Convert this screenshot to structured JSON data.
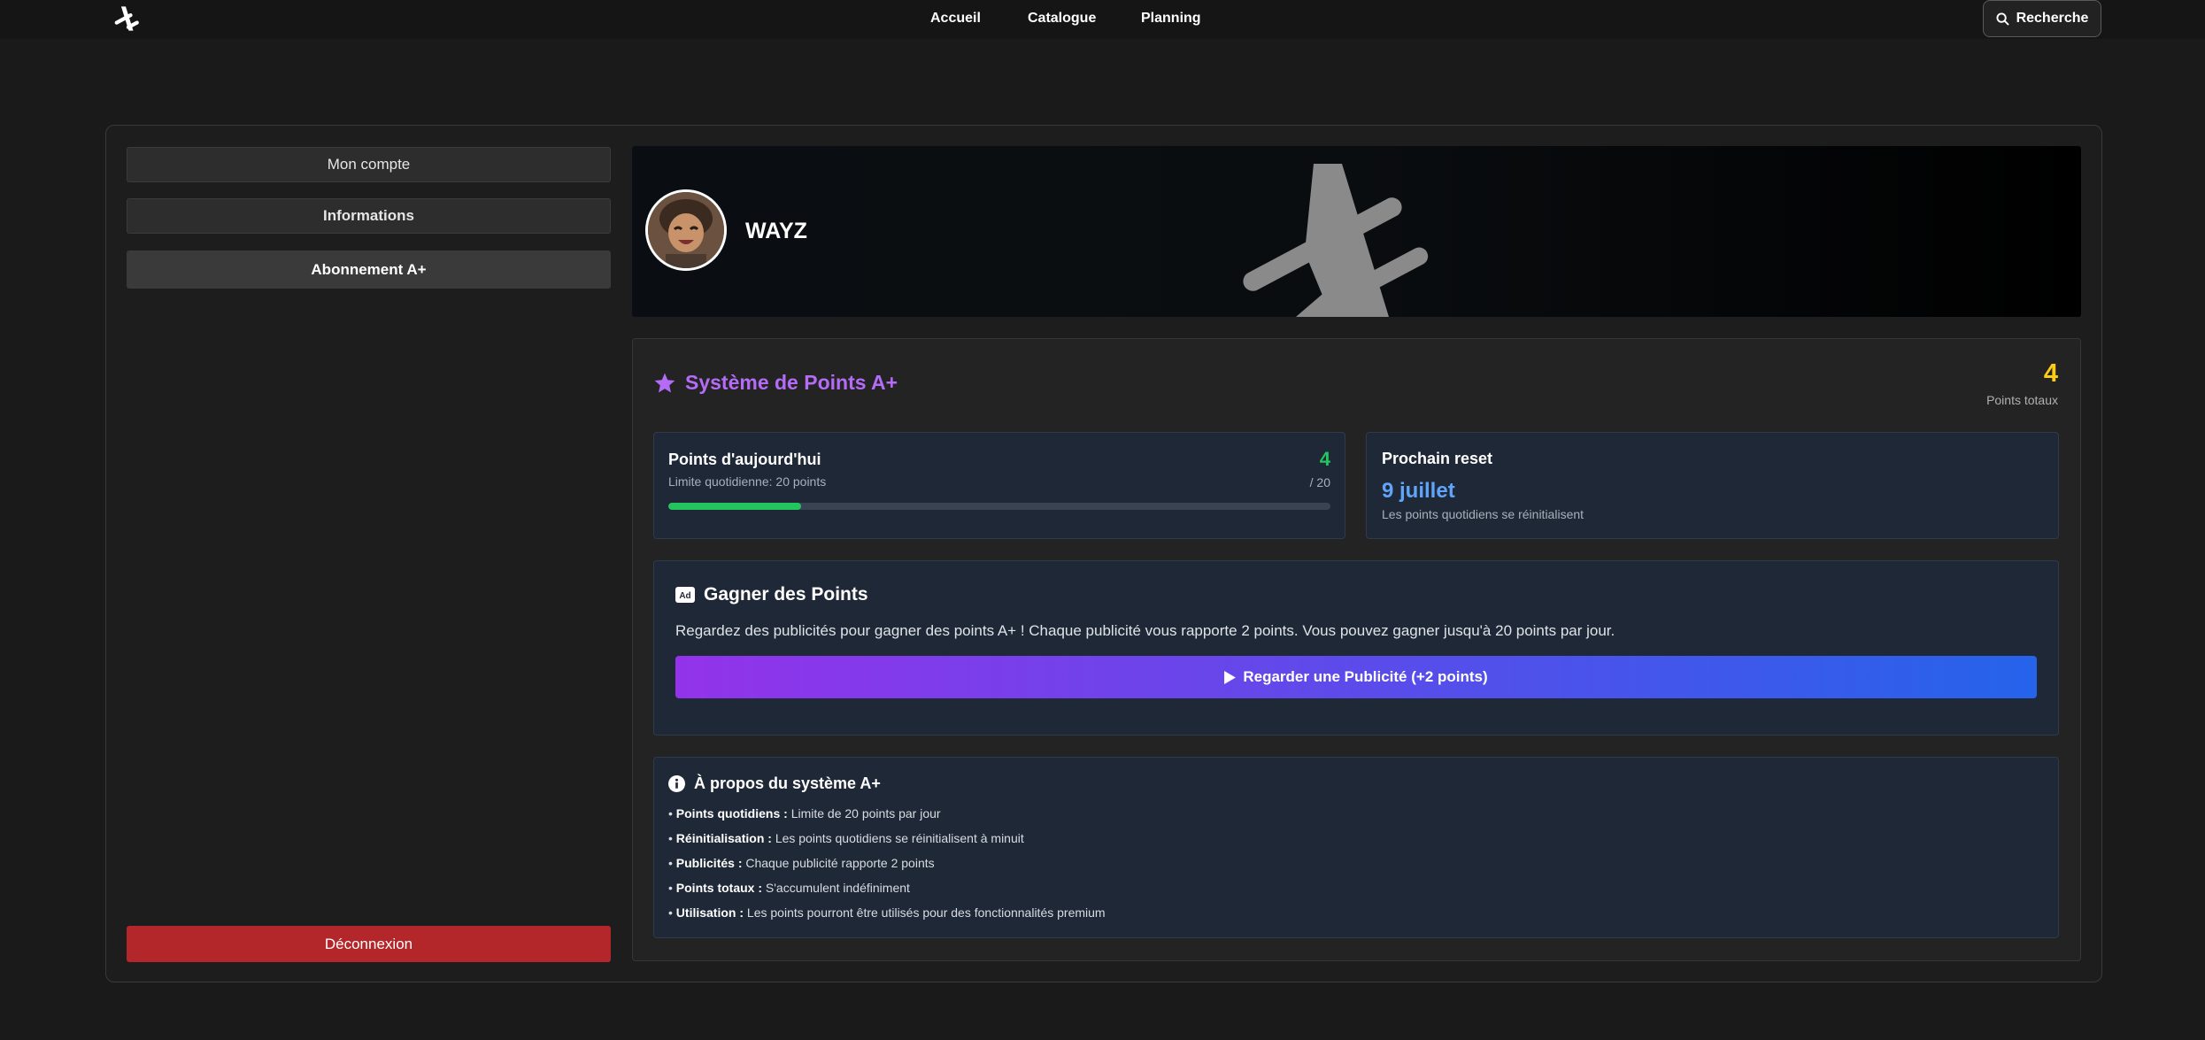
{
  "nav": {
    "items": [
      "Accueil",
      "Catalogue",
      "Planning"
    ],
    "search_label": "Recherche"
  },
  "sidebar": {
    "items": [
      {
        "label": "Mon compte"
      },
      {
        "label": "Informations"
      },
      {
        "label": "Abonnement A+"
      }
    ],
    "logout_label": "Déconnexion"
  },
  "profile": {
    "username": "WAYZ"
  },
  "points": {
    "title": "Système de Points A+",
    "total_value": "4",
    "total_label": "Points totaux",
    "today": {
      "title": "Points d'aujourd'hui",
      "limit_text": "Limite quotidienne: 20 points",
      "value": "4",
      "max_text": "/ 20",
      "progress_fraction": 0.2
    },
    "reset": {
      "title": "Prochain reset",
      "date": "9 juillet",
      "caption": "Les points quotidiens se réinitialisent"
    },
    "earn": {
      "title": "Gagner des Points",
      "description": "Regardez des publicités pour gagner des points A+ ! Chaque publicité vous rapporte 2 points. Vous pouvez gagner jusqu'à 20 points par jour.",
      "button_label": "Regarder une Publicité (+2 points)"
    },
    "about": {
      "title": "À propos du système A+",
      "items": [
        {
          "term": "Points quotidiens :",
          "text": "Limite de 20 points par jour"
        },
        {
          "term": "Réinitialisation :",
          "text": "Les points quotidiens se réinitialisent à minuit"
        },
        {
          "term": "Publicités :",
          "text": "Chaque publicité rapporte 2 points"
        },
        {
          "term": "Points totaux :",
          "text": "S'accumulent indéfiniment"
        },
        {
          "term": "Utilisation :",
          "text": "Les points pourront être utilisés pour des fonctionnalités premium"
        }
      ]
    }
  },
  "colors": {
    "accent_purple": "#b46cf7",
    "total_yellow": "#facc15",
    "today_green": "#22c55e",
    "reset_blue": "#60a5fa",
    "logout_red": "#b3262a"
  }
}
